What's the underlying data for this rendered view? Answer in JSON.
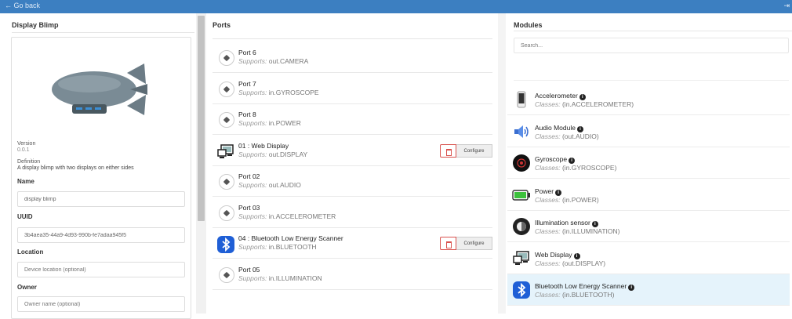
{
  "topbar": {
    "goback": "← Go back",
    "right_glyph": "⇥"
  },
  "left": {
    "title": "Display Blimp",
    "version_label": "Version",
    "version_value": "0.0.1",
    "definition_label": "Definition",
    "definition_value": "A display blimp with two displays on either sides",
    "name_label": "Name",
    "name_value": "display blimp",
    "uuid_label": "UUID",
    "uuid_value": "3b4aea35-44a9-4d93-990b-fe7adaa945f5",
    "location_label": "Location",
    "location_placeholder": "Device location (optional)",
    "owner_label": "Owner",
    "owner_placeholder": "Owner name (optional)"
  },
  "ports": {
    "title": "Ports",
    "supports_prefix": "Supports:",
    "configure_label": "Configure",
    "items": [
      {
        "name": "Port 6",
        "supports": "out.CAMERA",
        "icon": "cube-icon",
        "configured": false
      },
      {
        "name": "Port 7",
        "supports": "in.GYROSCOPE",
        "icon": "cube-icon",
        "configured": false
      },
      {
        "name": "Port 8",
        "supports": "in.POWER",
        "icon": "cube-icon",
        "configured": false
      },
      {
        "name": "01 : Web Display",
        "supports": "out.DISPLAY",
        "icon": "web-display-icon",
        "configured": true
      },
      {
        "name": "Port 02",
        "supports": "out.AUDIO",
        "icon": "cube-icon",
        "configured": false
      },
      {
        "name": "Port 03",
        "supports": "in.ACCELEROMETER",
        "icon": "cube-icon",
        "configured": false
      },
      {
        "name": "04 : Bluetooth Low Energy Scanner",
        "supports": "in.BLUETOOTH",
        "icon": "bluetooth-icon",
        "configured": true
      },
      {
        "name": "Port 05",
        "supports": "in.ILLUMINATION",
        "icon": "cube-icon",
        "configured": false
      }
    ]
  },
  "modules": {
    "title": "Modules",
    "search_placeholder": "Search...",
    "classes_prefix": "Classes:",
    "items": [
      {
        "name": "Accelerometer",
        "classes": "(in.ACCELEROMETER)",
        "icon": "phone-icon",
        "selected": false
      },
      {
        "name": "Audio Module",
        "classes": "(out.AUDIO)",
        "icon": "speaker-icon",
        "selected": false
      },
      {
        "name": "Gyroscope",
        "classes": "(in.GYROSCOPE)",
        "icon": "gyroscope-icon",
        "selected": false
      },
      {
        "name": "Power",
        "classes": "(in.POWER)",
        "icon": "battery-icon",
        "selected": false
      },
      {
        "name": "Illumination sensor",
        "classes": "(in.ILLUMINATION)",
        "icon": "light-sensor-icon",
        "selected": false
      },
      {
        "name": "Web Display",
        "classes": "(out.DISPLAY)",
        "icon": "web-display-icon",
        "selected": false
      },
      {
        "name": "Bluetooth Low Energy Scanner",
        "classes": "(in.BLUETOOTH)",
        "icon": "bluetooth-icon",
        "selected": true
      }
    ]
  },
  "colors": {
    "topbar": "#3c7fc1",
    "delete": "#d9534f",
    "selected_row": "#e5f3fb",
    "battery": "#3cc13c"
  }
}
